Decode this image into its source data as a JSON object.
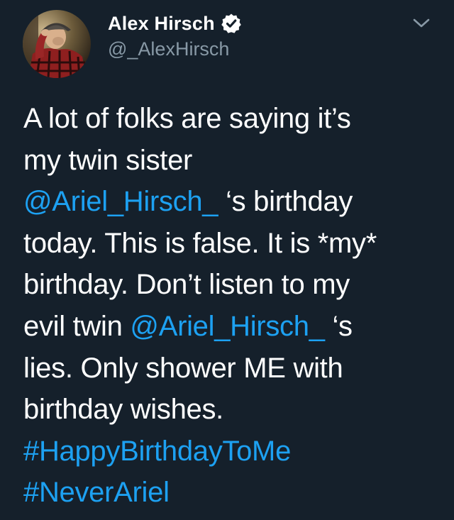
{
  "user": {
    "display_name": "Alex Hirsch",
    "handle": "@_AlexHirsch",
    "verified": true
  },
  "icons": {
    "verified": "verified-badge-icon",
    "menu": "chevron-down-icon"
  },
  "colors": {
    "background": "#15202b",
    "text": "#ffffff",
    "secondary": "#8899a6",
    "link": "#1da1f2"
  },
  "tweet": {
    "lines": [
      [
        {
          "text": "A lot of folks are saying it’s"
        }
      ],
      [
        {
          "text": "my twin sister"
        }
      ],
      [
        {
          "text": "@Ariel_Hirsch_",
          "link": true
        },
        {
          "text": " ‘s birthday"
        }
      ],
      [
        {
          "text": "today. This is false. It is *my*"
        }
      ],
      [
        {
          "text": "birthday. Don’t listen to my"
        }
      ],
      [
        {
          "text": "evil twin "
        },
        {
          "text": "@Ariel_Hirsch_",
          "link": true
        },
        {
          "text": " ‘s"
        }
      ],
      [
        {
          "text": "lies. Only shower ME with"
        }
      ],
      [
        {
          "text": "birthday wishes."
        }
      ],
      [
        {
          "text": "#HappyBirthdayToMe",
          "link": true
        }
      ],
      [
        {
          "text": "#NeverAriel",
          "link": true
        }
      ]
    ]
  }
}
